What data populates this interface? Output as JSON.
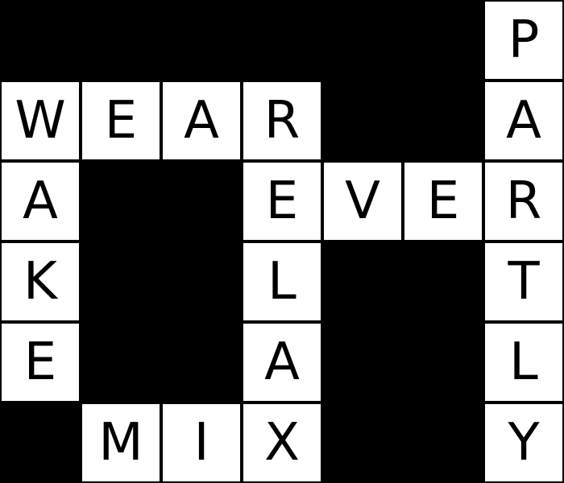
{
  "grid": {
    "rows": 6,
    "cols": 7,
    "cells": [
      [
        "#",
        "#",
        "#",
        "#",
        "#",
        "#",
        "P"
      ],
      [
        "W",
        "E",
        "A",
        "R",
        "#",
        "#",
        "A"
      ],
      [
        "A",
        "#",
        "#",
        "E",
        "V",
        "E",
        "R"
      ],
      [
        "K",
        "#",
        "#",
        "L",
        "#",
        "#",
        "T"
      ],
      [
        "E",
        "#",
        "#",
        "A",
        "#",
        "#",
        "L"
      ],
      [
        "#",
        "M",
        "I",
        "X",
        "#",
        "#",
        "Y"
      ]
    ]
  },
  "colors": {
    "background": "#000000",
    "cell_fill": "#ffffff",
    "letter": "#000000",
    "block": "#000000"
  }
}
